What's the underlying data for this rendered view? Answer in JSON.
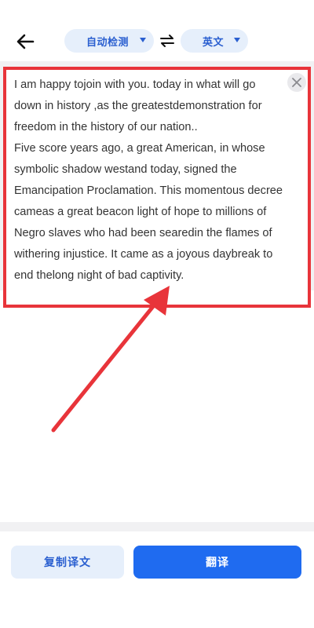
{
  "header": {
    "source_language": "自动检测",
    "target_language": "英文"
  },
  "input": {
    "paragraphs": [
      "  I am happy tojoin with you. today in what will go down in history ,as the greatestdemonstration for freedom in the history of our nation..",
      "Five score years ago, a great American, in whose symbolic shadow westand today, signed the Emancipation Proclamation. This momentous decree cameas a great beacon light of hope to millions of Negro slaves who had been searedin the flames of withering injustice. It came as a joyous daybreak to end thelong night of bad captivity."
    ]
  },
  "actions": {
    "copy_label": "复制译文",
    "translate_label": "翻译"
  },
  "colors": {
    "accent": "#1f6bf0",
    "accent_light": "#e6effb",
    "annotation": "#e8343a"
  }
}
